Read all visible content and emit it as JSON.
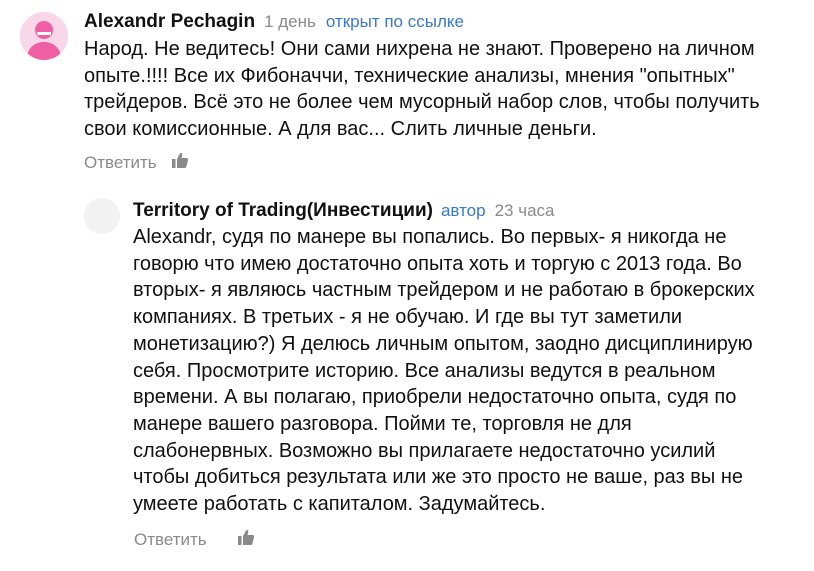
{
  "comments": [
    {
      "author": "Alexandr Pechagin",
      "time": "1 день",
      "status": "открыт по ссылке",
      "lines": [
        "Народ. Не ведитесь! Они сами нихрена не знают. Проверено на личном",
        "опыте.!!!! Все их Фибоначчи, технические анализы, мнения \"опытных\"",
        "трейдеров. Всё это не более чем мусорный набор слов, чтобы получить",
        "свои комиссионные. А для вас... Слить личные деньги."
      ],
      "reply_label": "Ответить",
      "avatar_color": "#ef5fa3",
      "like_icon": "thumbs-up-icon"
    },
    {
      "author": "Territory of Trading(Инвестиции)",
      "badge": "автор",
      "time": "23 часа",
      "lines": [
        "Alexandr, судя по манере вы попались. Во первых- я никогда не",
        "говорю что имею достаточно опыта хоть и торгую с 2013 года. Во",
        "вторых- я являюсь частным трейдером и не работаю в брокерских",
        "компаниях. В третьих - я не обучаю. И где вы тут заметили",
        "монетизацию?) Я делюсь личным опытом, заодно дисциплинирую",
        "себя. Просмотрите историю. Все анализы ведутся в реальном",
        "времени. А вы полагаю, приобрели недостаточно опыта, судя по",
        "манере вашего разговора. Пойми те, торговля не для",
        "слабонервных. Возможно вы прилагаете недостаточно усилий",
        "чтобы добиться результата или же это просто не ваше, раз вы не",
        "умеете работать с капиталом. Задумайтесь."
      ],
      "reply_label": "Ответить",
      "avatar_color": "#f2f2f2",
      "like_icon": "thumbs-up-icon"
    }
  ],
  "colors": {
    "link": "#3a79c4",
    "muted": "#8a8a8a",
    "text": "#111111"
  }
}
